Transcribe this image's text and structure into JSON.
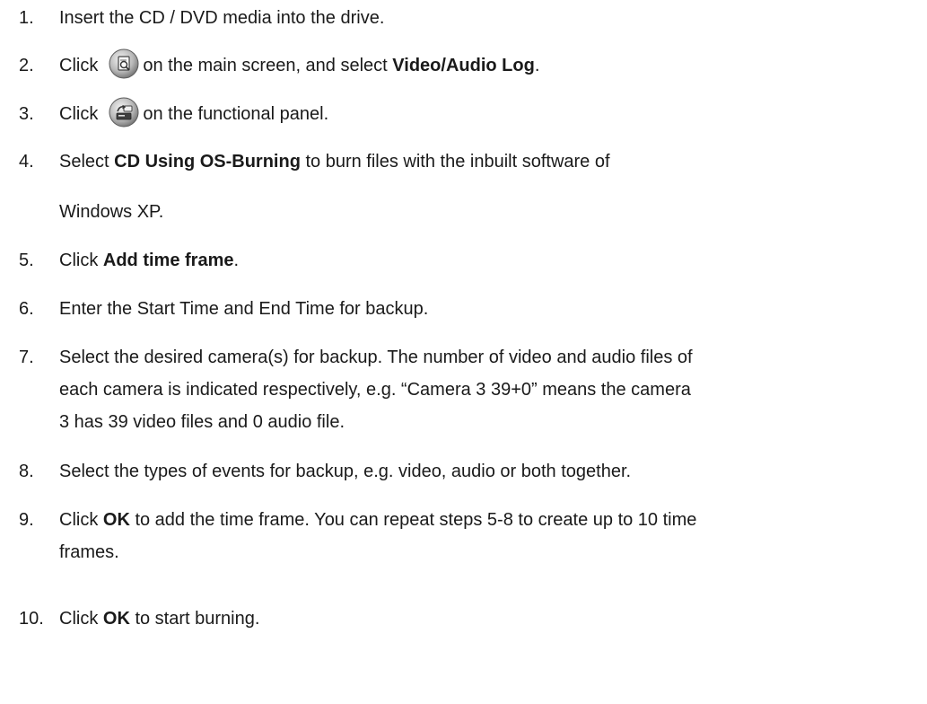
{
  "steps": [
    {
      "num": "1.",
      "text": "Insert the CD / DVD media into the drive."
    },
    {
      "num": "2.",
      "pre": "Click",
      "icon": "search-log-icon",
      "post": "on the main screen, and select ",
      "bold": "Video/Audio Log",
      "post2": "."
    },
    {
      "num": "3.",
      "pre": "Click",
      "icon": "backup-icon",
      "post": "on the functional panel."
    },
    {
      "num": "4.",
      "pre": "Select ",
      "bold": "CD Using OS-Burning",
      "post": " to burn files with the inbuilt software of",
      "line2": "Windows XP."
    },
    {
      "num": "5.",
      "pre": "Click ",
      "bold": "Add time frame",
      "post": "."
    },
    {
      "num": "6.",
      "text": "Enter the Start Time and End Time for backup."
    },
    {
      "num": "7.",
      "lines": [
        "Select the desired camera(s) for backup. The number of video and audio files of",
        "each camera is indicated respectively, e.g. “Camera 3 39+0” means the camera",
        "3 has 39 video files and 0 audio file."
      ]
    },
    {
      "num": "8.",
      "text": "Select the types of events for backup, e.g. video, audio or both together."
    },
    {
      "num": "9.",
      "pre": "Click ",
      "bold": "OK",
      "post": " to add the time frame. You can repeat steps 5-8 to create up to 10 time",
      "line2": "frames."
    },
    {
      "num": "10.",
      "pre": "Click ",
      "bold": "OK",
      "post": " to start burning."
    }
  ]
}
